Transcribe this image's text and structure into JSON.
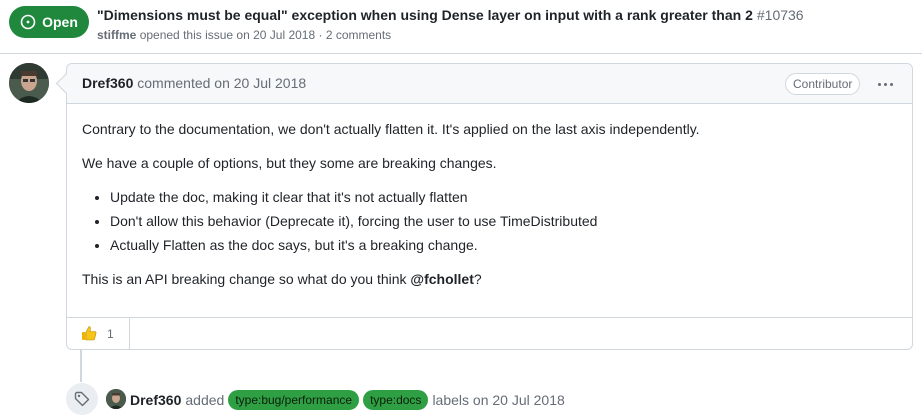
{
  "issue": {
    "state": "Open",
    "title": "\"Dimensions must be equal\" exception when using Dense layer on input with a rank greater than 2",
    "number": "#10736",
    "author": "stiffme",
    "opened_text": "opened this issue on 20 Jul 2018 · 2 comments"
  },
  "comment": {
    "author": "Dref360",
    "action": "commented on 20 Jul 2018",
    "role": "Contributor",
    "paragraphs": [
      "Contrary to the documentation, we don't actually flatten it. It's applied on the last axis independently.",
      "We have a couple of options, but they some are breaking changes."
    ],
    "bullets": [
      "Update the doc, making it clear that it's not actually flatten",
      "Don't allow this behavior (Deprecate it), forcing the user to use TimeDistributed",
      "Actually Flatten as the doc says, but it's a breaking change."
    ],
    "closing_prefix": "This is an API breaking change so what do you think ",
    "mention": "@fchollet",
    "closing_suffix": "?",
    "reaction_count": "1"
  },
  "event": {
    "actor": "Dref360",
    "verb": "added",
    "labels": [
      "type:bug/performance",
      "type:docs"
    ],
    "suffix": "labels on 20 Jul 2018"
  },
  "icons": {
    "state": "issue-opened-icon",
    "reaction": "thumbs-up-icon",
    "event": "tag-icon",
    "more": "kebab-horizontal-icon"
  },
  "colors": {
    "open": "#1f883d",
    "label_bg": "#2ea043",
    "border": "#d0d7de",
    "header_bg": "#f6f8fa"
  }
}
